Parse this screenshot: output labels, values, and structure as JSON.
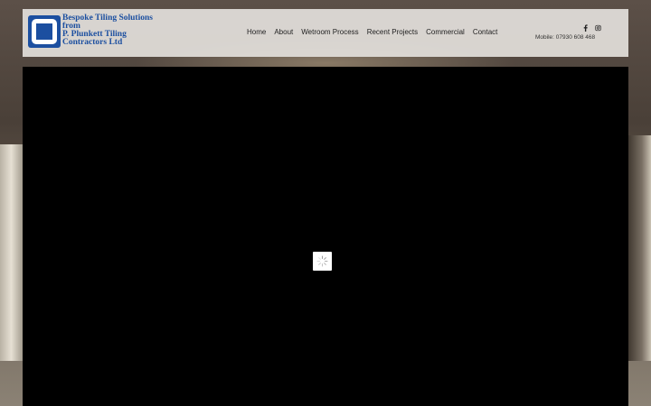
{
  "brand": {
    "lines": [
      "Bespoke Tiling Solutions",
      "from",
      "P. Plunkett Tiling",
      "Contractors Ltd"
    ]
  },
  "nav": {
    "items": [
      {
        "label": "Home"
      },
      {
        "label": "About"
      },
      {
        "label": "Wetroom Process"
      },
      {
        "label": "Recent Projects"
      },
      {
        "label": "Commercial"
      },
      {
        "label": "Contact"
      }
    ]
  },
  "social": {
    "icons": [
      "facebook-icon",
      "instagram-icon"
    ]
  },
  "contact": {
    "mobile": "Mobile: 07930 608 468"
  },
  "colors": {
    "brand_blue": "#1c4fa0",
    "header_bg": "#e2dfda",
    "player_bg": "#000000"
  }
}
